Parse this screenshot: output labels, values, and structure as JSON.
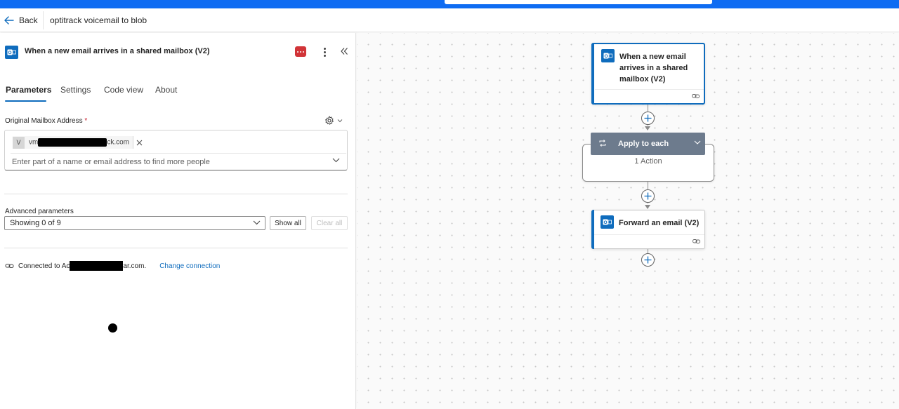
{
  "header": {
    "back_label": "Back",
    "flow_title": "optitrack voicemail to blob"
  },
  "panel": {
    "title": "When a new email arrives in a shared mailbox (V2)",
    "tabs": [
      {
        "label": "Parameters",
        "active": true
      },
      {
        "label": "Settings",
        "active": false
      },
      {
        "label": "Code view",
        "active": false
      },
      {
        "label": "About",
        "active": false
      }
    ],
    "mailbox": {
      "label": "Original Mailbox Address",
      "required_mark": "*",
      "chip_initial": "V",
      "chip_prefix": "vm",
      "chip_suffix": "ck.com",
      "placeholder": "Enter part of a name or email address to find more people"
    },
    "advanced": {
      "label": "Advanced parameters",
      "selected": "Showing 0 of 9",
      "show_all_label": "Show all",
      "clear_all_label": "Clear all"
    },
    "connection": {
      "prefix": "Connected to Ac",
      "suffix": "ar.com.",
      "change_label": "Change connection"
    }
  },
  "canvas": {
    "trigger": {
      "line1": "When a new email",
      "line2": "arrives in a shared",
      "line3": "mailbox (V2)"
    },
    "scope": {
      "title": "Apply to each",
      "count": "1 Action"
    },
    "action": {
      "title": "Forward an email (V2)"
    }
  },
  "colors": {
    "accent": "#0f6cbd",
    "topbar": "#0f6cf2",
    "scope_header": "#6d7b8d",
    "red_button": "#d13438"
  },
  "icons": [
    "back-arrow-icon",
    "outlook-icon",
    "more-options-icon",
    "collapse-panel-icon",
    "gear-icon",
    "chevron-down-icon",
    "close-icon",
    "connection-icon",
    "loop-icon",
    "add-step-icon",
    "link-icon"
  ]
}
